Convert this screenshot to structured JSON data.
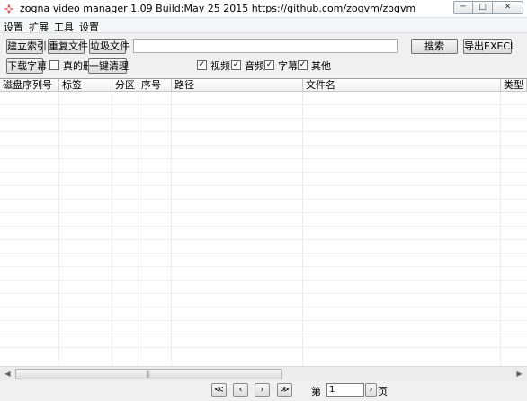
{
  "window": {
    "title": "zogna video manager 1.09 Build:May 25 2015  https://github.com/zogvm/zogvm",
    "app_icon": "zogna-logo-icon",
    "controls": {
      "minimize": "─",
      "maximize": "□",
      "close": "✕"
    }
  },
  "menu": [
    "设置",
    "扩展",
    "工具",
    "设置"
  ],
  "toolbar": {
    "build_index": "建立索引",
    "duplicates": "重复文件",
    "junk_files": "垃圾文件",
    "search_query": "",
    "search": "搜索",
    "export": "导出EXECL",
    "download_subtitles": "下载字幕",
    "real_delete": "真的删",
    "real_delete_checked": false,
    "one_click_clean": "一键清理"
  },
  "filters": [
    {
      "label": "视频",
      "checked": true
    },
    {
      "label": "音频",
      "checked": true
    },
    {
      "label": "字幕",
      "checked": true
    },
    {
      "label": "其他",
      "checked": true
    }
  ],
  "table": {
    "columns": [
      "磁盘序列号",
      "标签",
      "分区",
      "序号",
      "路径",
      "文件名",
      "类型"
    ],
    "rows": []
  },
  "scrollbar": {
    "left_arrow": "◀",
    "right_arrow": "▶",
    "grip": "|||"
  },
  "pager": {
    "first": "≪",
    "prev": "‹",
    "next": "›",
    "last": "≫",
    "page_prefix": "第",
    "page_value": "1",
    "go": "›",
    "page_suffix": "页"
  },
  "colors": {
    "background": "#f0f0f0",
    "grid_background": "#ffffff",
    "grid_line": "#ececec"
  }
}
